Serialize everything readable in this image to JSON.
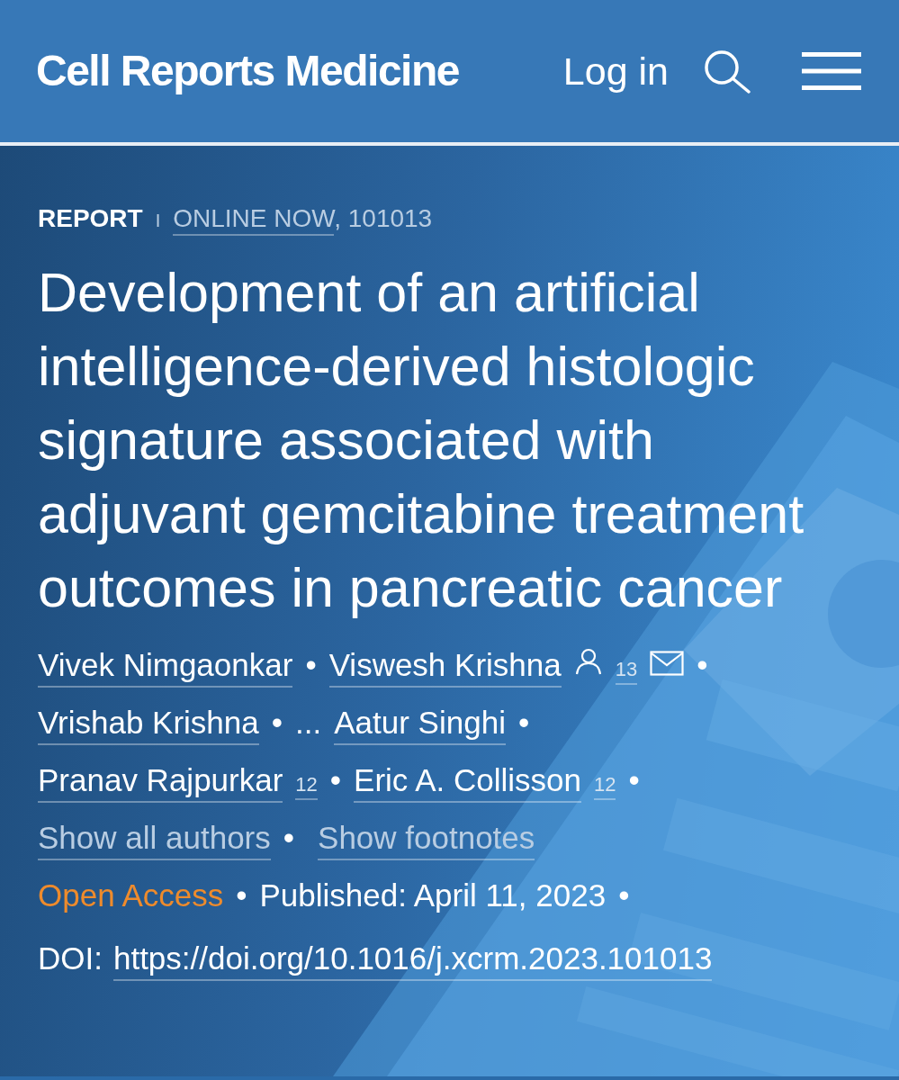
{
  "header": {
    "logo": "Cell Reports Medicine",
    "login": "Log in"
  },
  "article": {
    "type": "REPORT",
    "divider": "I",
    "status": "ONLINE NOW",
    "article_number": ", 101013",
    "title": "Development of an artificial intelligence-derived histologic signature associated with adjuvant gemcitabine treatment outcomes in pancreatic cancer",
    "author_lines": [
      [
        {
          "kind": "author",
          "name": "Vivek Nimgaonkar",
          "corresponding": false,
          "email": false,
          "separator": "•"
        },
        {
          "kind": "author",
          "name": "Viswesh Krishna",
          "corresponding": true,
          "affiliations": "13",
          "email": true,
          "separator": "•"
        }
      ],
      [
        {
          "kind": "author",
          "name": "Vrishab Krishna",
          "corresponding": false,
          "email": false,
          "separator": "•"
        },
        {
          "kind": "ellipsis",
          "name": "..."
        },
        {
          "kind": "author",
          "name": "Aatur Singhi",
          "corresponding": false,
          "email": false,
          "separator": "•"
        }
      ],
      [
        {
          "kind": "author",
          "name": "Pranav Rajpurkar",
          "corresponding": false,
          "affiliations": "12",
          "email": false,
          "separator": "•"
        },
        {
          "kind": "author",
          "name": "Eric A. Collisson",
          "corresponding": false,
          "affiliations": "12",
          "email": false,
          "separator": "•"
        }
      ]
    ],
    "toggles": [
      {
        "label": "Show all authors",
        "separator": "•"
      },
      {
        "label": "Show footnotes"
      }
    ],
    "access": "Open Access",
    "access_separator": "•",
    "published": "Published: April 11, 2023",
    "published_separator": "•",
    "doi_label": "DOI:",
    "doi": "https://doi.org/10.1016/j.xcrm.2023.101013"
  }
}
